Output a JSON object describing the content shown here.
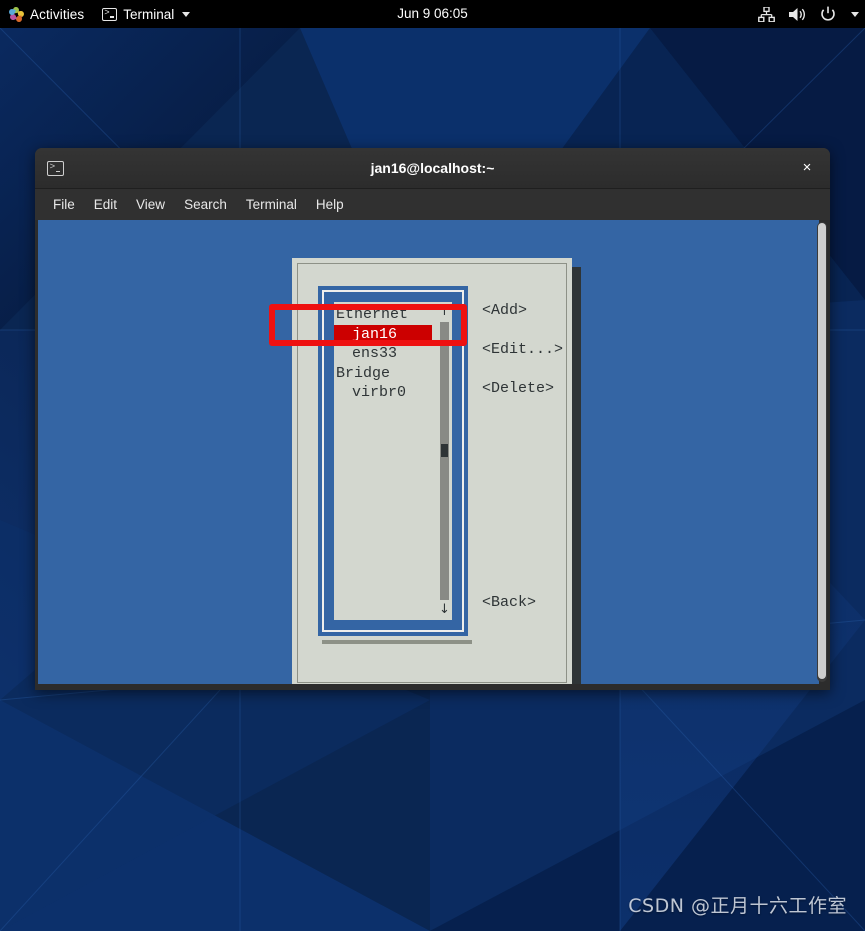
{
  "topbar": {
    "activities": "Activities",
    "app_menu": "Terminal",
    "clock": "Jun 9  06:05",
    "icons": [
      "network-wired-icon",
      "volume-icon",
      "power-icon",
      "chevron-down-icon"
    ],
    "activities_icon": "gnome-activities-icon",
    "app_icon": "terminal-icon"
  },
  "terminal": {
    "title": "jan16@localhost:~",
    "window_icon": "terminal-icon",
    "close_label": "×",
    "menus": [
      "File",
      "Edit",
      "View",
      "Search",
      "Terminal",
      "Help"
    ],
    "background_color": "#3465a4"
  },
  "nmtui": {
    "list": [
      {
        "label": "Ethernet",
        "type": "group",
        "selected": false
      },
      {
        "label": "jan16",
        "type": "item",
        "selected": true
      },
      {
        "label": "ens33",
        "type": "item",
        "selected": false
      },
      {
        "label": "Bridge",
        "type": "group",
        "selected": false
      },
      {
        "label": "virbr0",
        "type": "item",
        "selected": false
      }
    ],
    "scrollbar": {
      "up_arrow": "↑",
      "down_arrow": "↓"
    },
    "buttons": {
      "add": "<Add>",
      "edit": "<Edit...>",
      "delete": "<Delete>",
      "back": "<Back>"
    },
    "selection_color": "#cc0000",
    "frame_color": "#3465a4",
    "panel_color": "#d3d7cf"
  },
  "annotation": {
    "name": "red-highlight-rectangle",
    "color": "#ee1111",
    "targets": "jan16"
  },
  "watermark": {
    "text": "CSDN @正月十六工作室"
  }
}
